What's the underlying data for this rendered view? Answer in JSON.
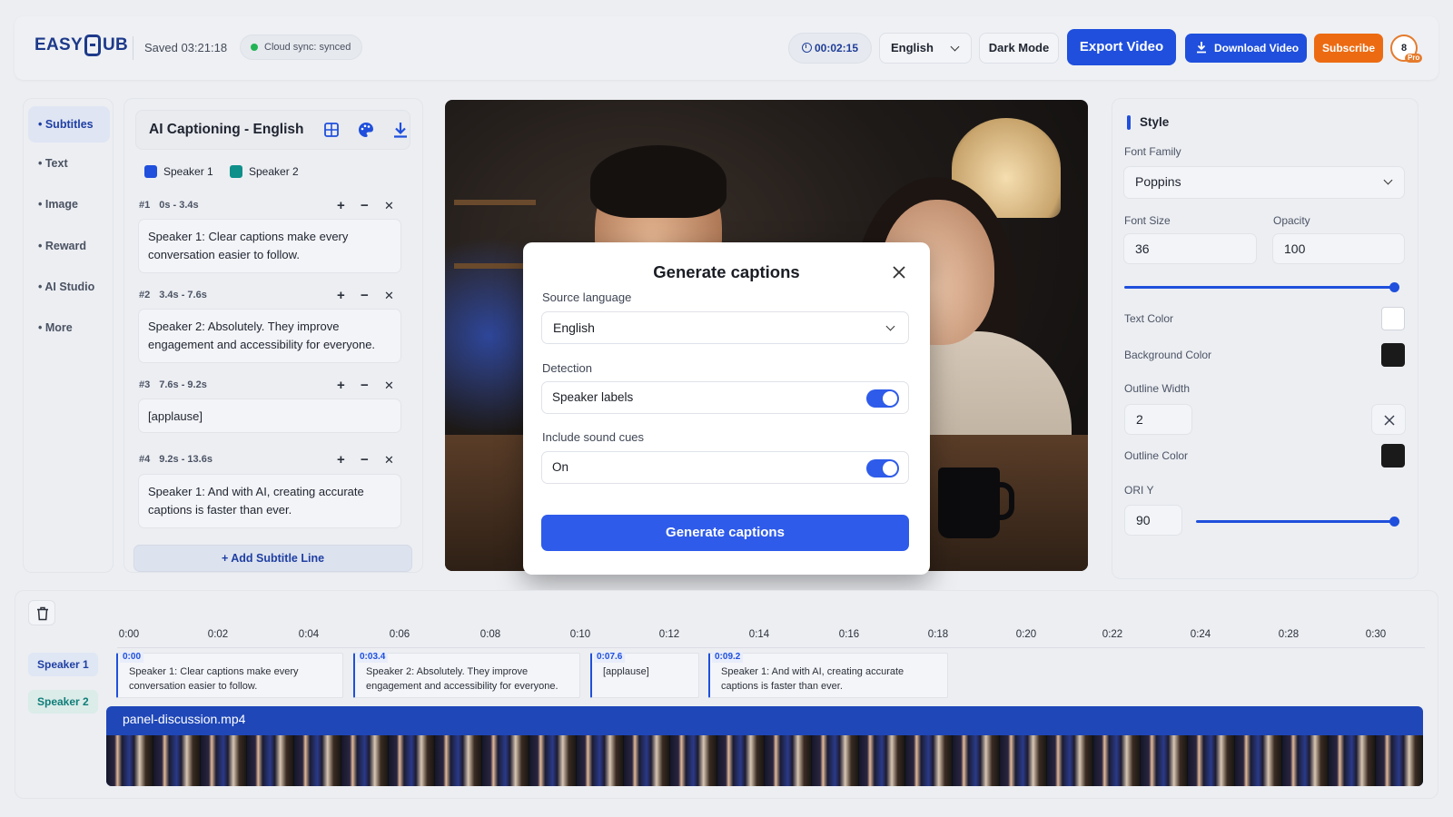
{
  "header": {
    "logo_text": "EASYSUB",
    "saved": "Saved 03:21:18",
    "sync_status": "Cloud sync: synced",
    "timer": "00:02:15",
    "language": "English",
    "dark_mode_label": "Dark Mode",
    "export_label": "Export Video",
    "download_label": "Download Video",
    "subscribe_label": "Subscribe",
    "avatar_initial": "8",
    "avatar_badge": "Pro"
  },
  "nav": {
    "items": [
      {
        "label": "• Subtitles",
        "active": true
      },
      {
        "label": "• Text"
      },
      {
        "label": "• Image"
      },
      {
        "label": "• Reward"
      },
      {
        "label": "• AI Studio"
      },
      {
        "label": "• More"
      }
    ]
  },
  "subtitles": {
    "title": "AI Captioning - English",
    "speakers": [
      {
        "name": "Speaker 1",
        "color": "#1f4fdc"
      },
      {
        "name": "Speaker 2",
        "color": "#0f8f8a"
      }
    ],
    "cues": [
      {
        "num": "#1",
        "time": "0s - 3.4s",
        "text": "Speaker 1: Clear captions make every conversation easier to follow."
      },
      {
        "num": "#2",
        "time": "3.4s - 7.6s",
        "text": "Speaker 2: Absolutely. They improve engagement and accessibility for everyone."
      },
      {
        "num": "#3",
        "time": "7.6s - 9.2s",
        "text": "[applause]"
      },
      {
        "num": "#4",
        "time": "9.2s - 13.6s",
        "text": "Speaker 1: And with AI, creating accurate captions is faster than ever."
      }
    ],
    "ctrl_plus": "+",
    "ctrl_minus": "−",
    "ctrl_close": "✕",
    "add_line_label": "+ Add Subtitle Line"
  },
  "modal": {
    "title": "Generate captions",
    "source_language_label": "Source language",
    "source_language_value": "English",
    "detection_label": "Detection",
    "speaker_labels": "Speaker labels",
    "sound_cues_label": "Include sound cues",
    "sound_cues_value": "On",
    "generate_label": "Generate captions"
  },
  "style": {
    "title": "Style",
    "font_family_label": "Font Family",
    "font_family_value": "Poppins",
    "font_size_label": "Font Size",
    "font_size_value": "36",
    "opacity_label": "Opacity",
    "opacity_value": "100",
    "text_color_label": "Text Color",
    "text_color": "#ffffff",
    "bg_color_label": "Background Color",
    "bg_color": "#1a1a1a",
    "outline_width_label": "Outline Width",
    "outline_width_value": "2",
    "outline_color_label": "Outline Color",
    "outline_color": "#1a1a1a",
    "ori_label": "ORI Y",
    "ori_value": "90",
    "opacity_fraction": 1.0,
    "ori_fraction": 1.0
  },
  "timeline": {
    "ticks": [
      "0:00",
      "0:02",
      "0:04",
      "0:06",
      "0:08",
      "0:10",
      "0:12",
      "0:14",
      "0:16",
      "0:18",
      "0:20",
      "0:22",
      "0:24",
      "0:28",
      "0:30"
    ],
    "speaker1_label": "Speaker 1",
    "speaker2_label": "Speaker 2",
    "clips": [
      {
        "start": "0:00",
        "text": "Speaker 1: Clear captions make every conversation easier to follow."
      },
      {
        "start": "0:03.4",
        "text": "Speaker 2: Absolutely. They improve engagement and accessibility for everyone."
      },
      {
        "start": "0:07.6",
        "text": "[applause]"
      },
      {
        "start": "0:09.2",
        "text": "Speaker 1: And with AI, creating accurate captions is faster than ever."
      }
    ],
    "video_file": "panel-discussion.mp4"
  },
  "colors": {
    "accent": "#1f4fdc",
    "subscribe": "#ec6b12",
    "sync_dot": "#22b355"
  },
  "icons": {
    "layout": "grid-icon",
    "palette": "palette-icon",
    "download": "download-icon",
    "close": "close-icon",
    "trash": "trash-icon",
    "clock": "clock-icon",
    "chevron": "chevron-down-icon"
  }
}
